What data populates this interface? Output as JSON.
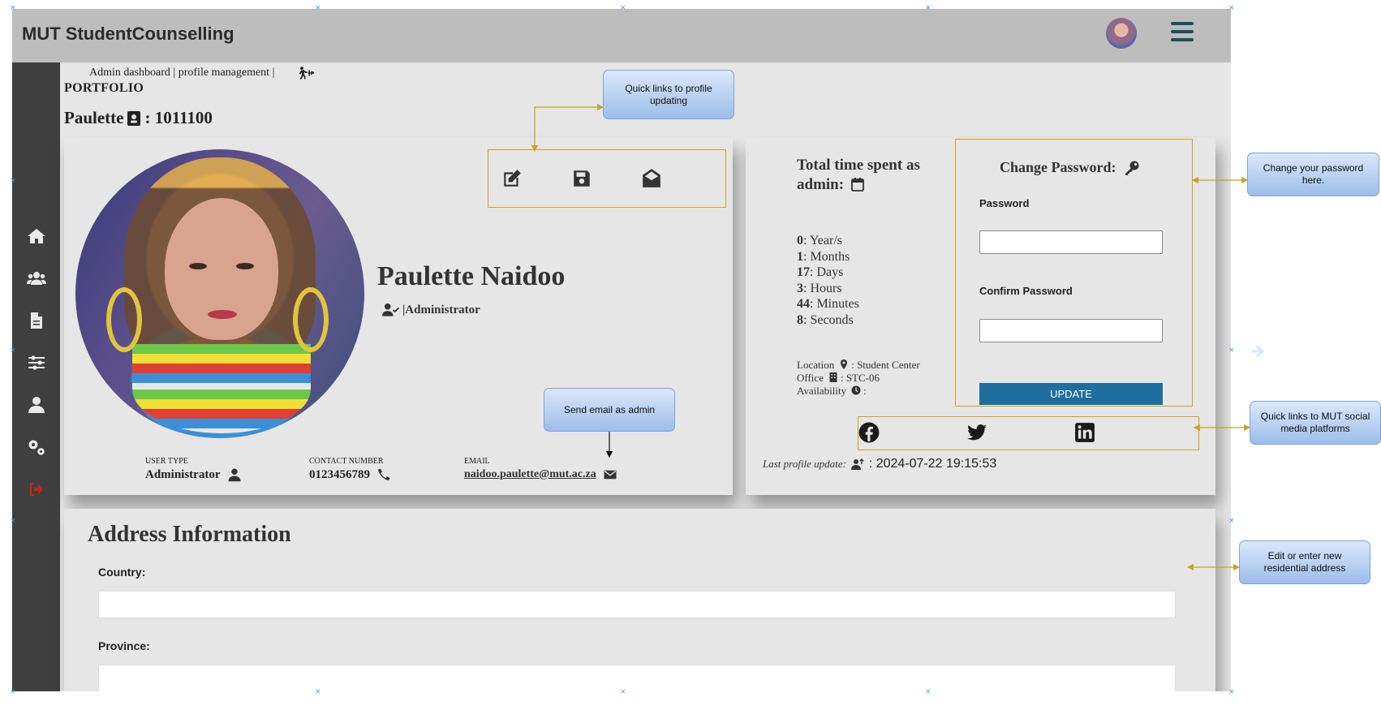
{
  "app": {
    "title": "MUT StudentCounselling"
  },
  "breadcrumb": {
    "text": "Admin dashboard | profile management |"
  },
  "page": {
    "section": "PORTFOLIO",
    "user_first_name": "Paulette",
    "user_id": ": 1011100"
  },
  "sidebar": {
    "items": [
      {
        "name": "home-icon"
      },
      {
        "name": "users-icon"
      },
      {
        "name": "file-icon"
      },
      {
        "name": "sliders-icon"
      },
      {
        "name": "user-icon"
      },
      {
        "name": "cogs-icon"
      },
      {
        "name": "logout-icon",
        "color": "#d31d1d"
      }
    ]
  },
  "profile": {
    "full_name": "Paulette Naidoo",
    "role_line": "|Administrator",
    "user_type_label": "USER TYPE",
    "user_type": "Administrator",
    "contact_label": "CONTACT NUMBER",
    "contact": "0123456789",
    "email_label": "EMAIL",
    "email": "naidoo.paulette@mut.ac.za"
  },
  "stats": {
    "title": "Total time spent as admin:",
    "years": {
      "value": "0",
      "unit": ": Year/s"
    },
    "months": {
      "value": "1",
      "unit": ": Months"
    },
    "days": {
      "value": "17",
      "unit": ": Days"
    },
    "hours": {
      "value": "3",
      "unit": ": Hours"
    },
    "minutes": {
      "value": "44",
      "unit": ": Minutes"
    },
    "seconds": {
      "value": "8",
      "unit": ": Seconds"
    },
    "location_label": "Location",
    "location_value": ": Student Center",
    "office_label": "Office",
    "office_value": ": STC-06",
    "availability_label": "Availability",
    "availability_value": ":"
  },
  "password": {
    "title": "Change Password:",
    "password_label": "Password",
    "confirm_label": "Confirm Password",
    "update_label": "UPDATE"
  },
  "last_update": {
    "label": "Last profile update:",
    "value": ": 2024-07-22 19:15:53"
  },
  "address": {
    "title": "Address Information",
    "country_label": "Country:",
    "province_label": "Province:"
  },
  "annotations": {
    "quick_links": "Quick links to profile updating",
    "send_email": "Send email as admin",
    "change_password": "Change your password here.",
    "social_links": "Quick links to MUT social media platforms",
    "edit_address": "Edit or enter new residential address"
  },
  "colors": {
    "topbar": "#bdbdbd",
    "sidebar": "#3f3f3f",
    "update_button": "#1f6ea0",
    "annotation_border": "#c9a227",
    "callout": "#9dbde9"
  }
}
